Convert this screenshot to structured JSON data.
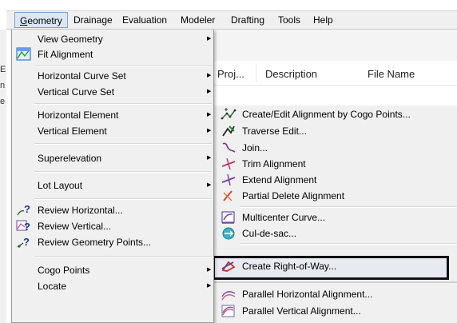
{
  "menubar": {
    "items": [
      {
        "label": "Geometry",
        "mnemonic_index": 0
      },
      {
        "label": "Drainage"
      },
      {
        "label": "Evaluation"
      },
      {
        "label": "Modeler"
      },
      {
        "label": "Drafting"
      },
      {
        "label": "Tools"
      },
      {
        "label": "Help"
      }
    ]
  },
  "background_window": {
    "columns": [
      "Proj...",
      "Description",
      "File Name"
    ],
    "left_fragments": [
      "E",
      "n",
      "e"
    ]
  },
  "geometry_menu": {
    "items": [
      {
        "label": "View Geometry",
        "has_submenu": true,
        "icon": ""
      },
      {
        "label": "Fit Alignment",
        "has_submenu": false,
        "icon": "fit-alignment-icon"
      },
      {
        "label": "Horizontal Curve Set",
        "has_submenu": true,
        "icon": ""
      },
      {
        "label": "Vertical Curve Set",
        "has_submenu": true,
        "icon": ""
      },
      {
        "label": "Horizontal Element",
        "has_submenu": true,
        "icon": ""
      },
      {
        "label": "Vertical Element",
        "has_submenu": true,
        "icon": ""
      },
      {
        "label": "Superelevation",
        "has_submenu": true,
        "icon": ""
      },
      {
        "label": "Lot Layout",
        "has_submenu": true,
        "icon": ""
      },
      {
        "label": "Review Horizontal...",
        "has_submenu": false,
        "icon": "review-horizontal-icon"
      },
      {
        "label": "Review Vertical...",
        "has_submenu": false,
        "icon": "review-vertical-icon"
      },
      {
        "label": "Review Geometry Points...",
        "has_submenu": false,
        "icon": "review-geometry-points-icon"
      },
      {
        "label": "Cogo Points",
        "has_submenu": true,
        "icon": ""
      },
      {
        "label": "Locate",
        "has_submenu": true,
        "icon": ""
      }
    ]
  },
  "submenu": {
    "items": [
      {
        "label": "Create/Edit Alignment by Cogo Points...",
        "icon": "cogo-alignment-icon"
      },
      {
        "label": "Traverse Edit...",
        "icon": "traverse-edit-icon"
      },
      {
        "label": "Join...",
        "icon": "join-icon"
      },
      {
        "label": "Trim Alignment",
        "icon": "trim-alignment-icon"
      },
      {
        "label": "Extend Alignment",
        "icon": "extend-alignment-icon"
      },
      {
        "label": "Partial Delete Alignment",
        "icon": "partial-delete-icon"
      },
      {
        "label": "Multicenter Curve...",
        "icon": "multicenter-curve-icon"
      },
      {
        "label": "Cul-de-sac...",
        "icon": "cul-de-sac-icon"
      },
      {
        "label": "Create Right-of-Way...",
        "icon": "create-right-of-way-icon",
        "highlighted": true
      },
      {
        "label": "Parallel Horizontal Alignment...",
        "icon": "parallel-horizontal-icon"
      },
      {
        "label": "Parallel Vertical Alignment...",
        "icon": "parallel-vertical-icon"
      }
    ]
  },
  "colors": {
    "menu_bg": "#f0f0f0",
    "menubar_selected_bg": "#dbe6f5",
    "menubar_selected_border": "#7da2ce",
    "highlight_border": "#111111"
  }
}
